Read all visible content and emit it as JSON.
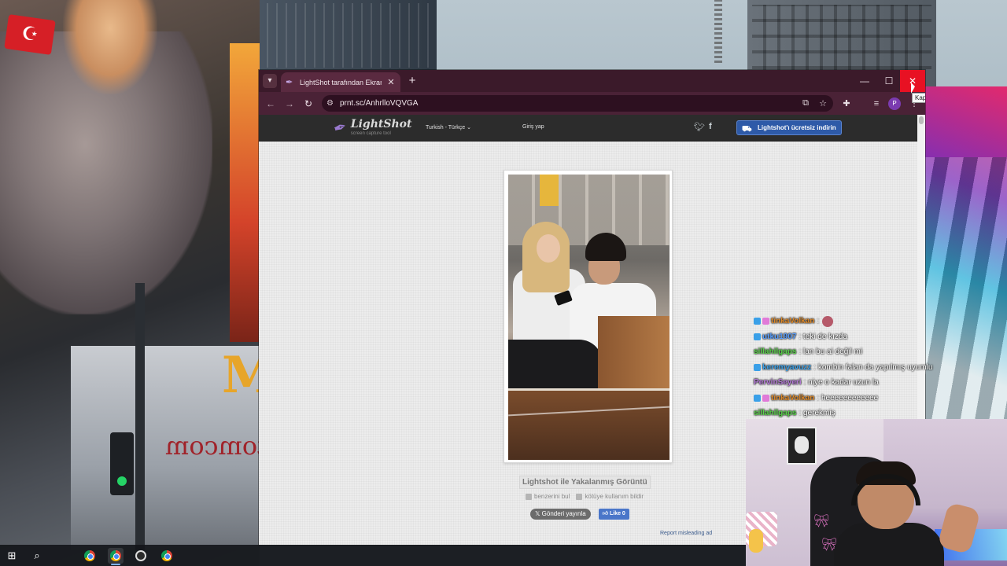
{
  "browser": {
    "tab_title": "LightShot tarafından Ekran Görüntüsü",
    "url": "prnt.sc/AnhrlloVQVGA",
    "close_tooltip": "Kapat",
    "avatar_letter": "P"
  },
  "lightshot": {
    "logo_name": "LightShot",
    "logo_tagline": "screen capture tool",
    "language": "Turkish - Türkçe",
    "login": "Giriş yap",
    "download_button": "Lightshot'ı ücretsiz indirin",
    "caption": "Lightshot ile Yakalanmış Görüntü",
    "find_similar": "benzerini bul",
    "report_abuse": "kötüye kullanım bildir",
    "post_button": "Gönderi yayınla",
    "like_button": "Like 0",
    "report_ad": "Report misleading ad"
  },
  "chat": {
    "messages": [
      {
        "user": "tinkaVolkan",
        "text": " : ",
        "color": "#e08a2a",
        "badges": 2,
        "emote": true
      },
      {
        "user": "utku1907",
        "text": " : teki de kızda",
        "color": "#5aa0ff",
        "badges": 1,
        "emote": false
      },
      {
        "user": "sillahilgaps",
        "text": " : lan bu ai değil mi",
        "color": "#5ad44a",
        "badges": 0,
        "emote": false
      },
      {
        "user": "keremyavuzz",
        "text": " : kombin falan da yapılmış uyumlu",
        "color": "#3aa0e8",
        "badges": 1,
        "emote": false
      },
      {
        "user": "PervinSeyeri",
        "text": " : niye o kadar uzun la",
        "color": "#b57ad8",
        "badges": 0,
        "emote": false
      },
      {
        "user": "tinkaVolkan",
        "text": " : heeeeeeeeeeee",
        "color": "#e08a2a",
        "badges": 2,
        "emote": false
      },
      {
        "user": "sillahilgaps",
        "text": " : gerekmiş",
        "color": "#5ad44a",
        "badges": 0,
        "emote": false
      }
    ]
  },
  "scene": {
    "store_sign": "fotomcom"
  }
}
